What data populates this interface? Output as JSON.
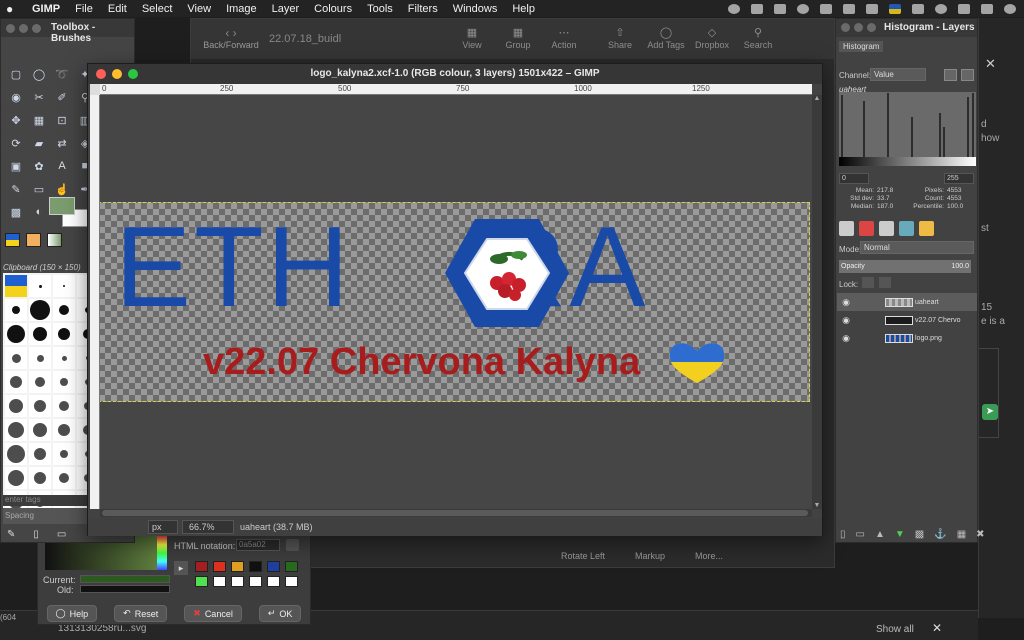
{
  "menubar": {
    "items": [
      "GIMP",
      "File",
      "Edit",
      "Select",
      "View",
      "Image",
      "Layer",
      "Colours",
      "Tools",
      "Filters",
      "Windows",
      "Help"
    ]
  },
  "background_window": {
    "nav_label": "Back/Forward",
    "title": "22.07.18_buidl",
    "toolbar": [
      "View",
      "Group",
      "Action",
      "Share",
      "Add Tags",
      "Dropbox",
      "Search"
    ],
    "bottom": [
      "Rotate Left",
      "Markup",
      "More..."
    ]
  },
  "right_app": {
    "t1": [
      "d",
      "how"
    ],
    "t2": "st",
    "t3": [
      "15",
      "e is a"
    ]
  },
  "bottom_strip": {
    "count": "(604",
    "filename": "1313130258ru...svg",
    "show_all": "Show all"
  },
  "toolbox": {
    "title": "Toolbox - Brushes",
    "fg_color": "#7b9c6e",
    "bg_color": "#ffffff",
    "clipboard_label": "Clipboard (150 × 150)",
    "filter_tags_placeholder": "enter tags",
    "spacing_label": "Spacing"
  },
  "color_dialog": {
    "html_notation_label": "HTML notation:",
    "html_value": "0a5a02",
    "current_label": "Current:",
    "old_label": "Old:",
    "history_colors": [
      "#a52020",
      "#e03020",
      "#e0a020",
      "#111111",
      "#2040a0",
      "#2a6a20",
      "#50e050",
      "#ffffff",
      "#ffffff",
      "#ffffff",
      "#ffffff",
      "#ffffff"
    ],
    "buttons": {
      "help": "Help",
      "reset": "Reset",
      "cancel": "Cancel",
      "ok": "OK"
    }
  },
  "image_window": {
    "title": "logo_kalyna2.xcf-1.0 (RGB colour, 3 layers) 1501x422 – GIMP",
    "ruler_labels": [
      "0",
      "250",
      "500",
      "750",
      "1000",
      "1250"
    ],
    "canvas": {
      "logo_text_left": "ETH",
      "logo_text_right": "RA",
      "version_line": "v22.07 Chervona Kalyna",
      "brand_blue": "#1a4aa8",
      "brand_red": "#a71d1d",
      "ukraine_blue": "#2f6cd0",
      "ukraine_yellow": "#f3cf1f"
    },
    "status": {
      "unit": "px",
      "zoom": "66.7%",
      "message": "uaheart (38.7 MB)"
    }
  },
  "dock": {
    "title": "Histogram - Layers",
    "histogram_tab": "Histogram",
    "channel_label": "Channel:",
    "channel_value": "Value",
    "active_layer": "uaheart",
    "range_min": "0",
    "range_max": "255",
    "stats": [
      {
        "k1": "Mean:",
        "v1": "217.8",
        "k2": "Pixels:",
        "v2": "4553"
      },
      {
        "k1": "Std dev:",
        "v1": "33.7",
        "k2": "Count:",
        "v2": "4553"
      },
      {
        "k1": "Median:",
        "v1": "187.0",
        "k2": "Percentile:",
        "v2": "100.0"
      }
    ],
    "mode_label": "Mode:",
    "mode_value": "Normal",
    "opacity_label": "Opacity",
    "opacity_value": "100.0",
    "lock_label": "Lock:",
    "layers": [
      {
        "name": "uaheart"
      },
      {
        "name": "v22.07 Chervo"
      },
      {
        "name": "logo.png"
      }
    ]
  }
}
